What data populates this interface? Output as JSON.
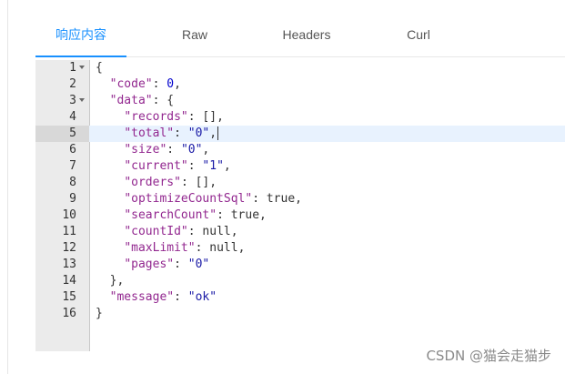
{
  "tabs": [
    {
      "label": "响应内容",
      "active": true
    },
    {
      "label": "Raw",
      "active": false
    },
    {
      "label": "Headers",
      "active": false
    },
    {
      "label": "Curl",
      "active": false
    }
  ],
  "editor": {
    "active_line": 5,
    "lines": [
      {
        "n": "1",
        "fold": true
      },
      {
        "n": "2"
      },
      {
        "n": "3",
        "fold": true
      },
      {
        "n": "4"
      },
      {
        "n": "5"
      },
      {
        "n": "6"
      },
      {
        "n": "7"
      },
      {
        "n": "8"
      },
      {
        "n": "9"
      },
      {
        "n": "10"
      },
      {
        "n": "11"
      },
      {
        "n": "12"
      },
      {
        "n": "13"
      },
      {
        "n": "14"
      },
      {
        "n": "15"
      },
      {
        "n": "16"
      }
    ],
    "json": {
      "code_key": "\"code\"",
      "code_val": "0",
      "data_key": "\"data\"",
      "records_key": "\"records\"",
      "records_val": "[]",
      "total_key": "\"total\"",
      "total_val": "\"0\"",
      "size_key": "\"size\"",
      "size_val": "\"0\"",
      "current_key": "\"current\"",
      "current_val": "\"1\"",
      "orders_key": "\"orders\"",
      "orders_val": "[]",
      "optimize_key": "\"optimizeCountSql\"",
      "optimize_val": "true",
      "search_key": "\"searchCount\"",
      "search_val": "true",
      "countid_key": "\"countId\"",
      "countid_val": "null",
      "maxlimit_key": "\"maxLimit\"",
      "maxlimit_val": "null",
      "pages_key": "\"pages\"",
      "pages_val": "\"0\"",
      "message_key": "\"message\"",
      "message_val": "\"ok\""
    }
  },
  "watermark": "CSDN @猫会走猫步"
}
